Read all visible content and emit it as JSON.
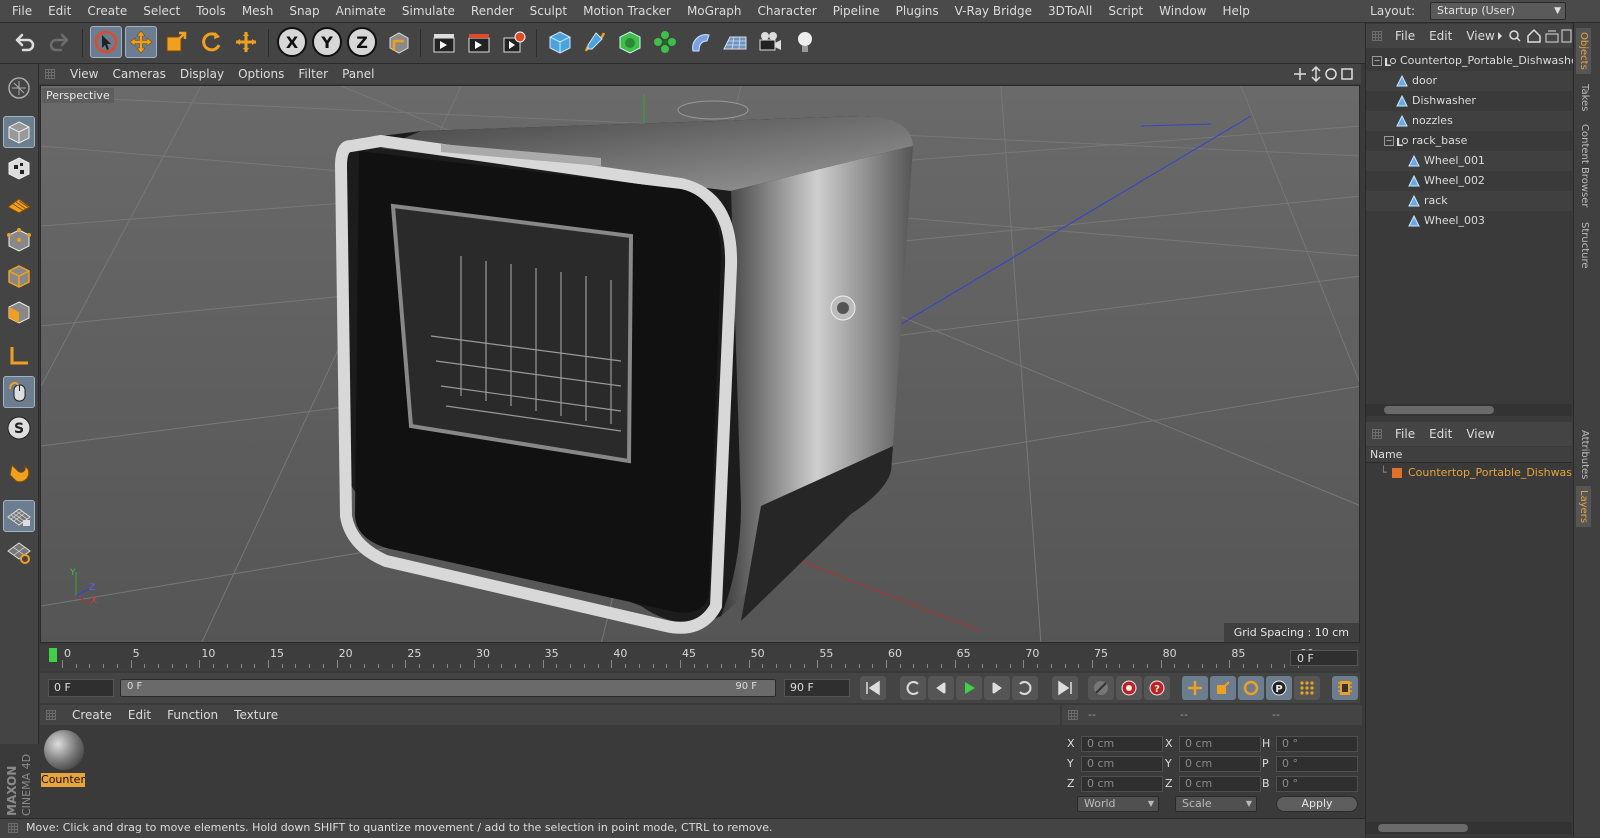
{
  "menubar": {
    "items": [
      "File",
      "Edit",
      "Create",
      "Select",
      "Tools",
      "Mesh",
      "Snap",
      "Animate",
      "Simulate",
      "Render",
      "Sculpt",
      "Motion Tracker",
      "MoGraph",
      "Character",
      "Pipeline",
      "Plugins",
      "V-Ray Bridge",
      "3DToAll",
      "Script",
      "Window",
      "Help"
    ],
    "layout_label": "Layout:",
    "layout_value": "Startup (User)"
  },
  "toolbar": {
    "undo_icon": "undo-icon",
    "axis_x": "X",
    "axis_y": "Y",
    "axis_z": "Z"
  },
  "viewport": {
    "menu": [
      "View",
      "Cameras",
      "Display",
      "Options",
      "Filter",
      "Panel"
    ],
    "camera_label": "Perspective",
    "grid_spacing": "Grid Spacing : 10 cm",
    "axis_x": "X",
    "axis_y": "Y",
    "axis_z": "Z"
  },
  "timeline": {
    "labels": [
      "0",
      "5",
      "10",
      "15",
      "20",
      "25",
      "30",
      "35",
      "40",
      "45",
      "50",
      "55",
      "60",
      "65",
      "70",
      "75",
      "80",
      "85",
      "90"
    ],
    "end_field": "0 F"
  },
  "transport": {
    "current_frame": "0 F",
    "range_start": "0 F",
    "range_end_inner": "90 F",
    "range_end": "90 F"
  },
  "material_manager": {
    "menu": [
      "Create",
      "Edit",
      "Function",
      "Texture"
    ],
    "material_name": "Counter"
  },
  "coordinates": {
    "headers": [
      "--",
      "--",
      "--"
    ],
    "rows": [
      {
        "l1": "X",
        "v1": "0 cm",
        "l2": "X",
        "v2": "0 cm",
        "l3": "H",
        "v3": "0 °"
      },
      {
        "l1": "Y",
        "v1": "0 cm",
        "l2": "Y",
        "v2": "0 cm",
        "l3": "P",
        "v3": "0 °"
      },
      {
        "l1": "Z",
        "v1": "0 cm",
        "l2": "Z",
        "v2": "0 cm",
        "l3": "B",
        "v3": "0 °"
      }
    ],
    "space_select": "World",
    "mode_select": "Scale",
    "apply_label": "Apply"
  },
  "status_text": "Move: Click and drag to move elements. Hold down SHIFT to quantize movement / add to the selection in point mode, CTRL to remove.",
  "brand": {
    "line1": "MAXON",
    "line2": "CINEMA 4D"
  },
  "objects_panel": {
    "menu": [
      "File",
      "Edit",
      "View"
    ],
    "items": [
      {
        "name": "Countertop_Portable_Dishwasher_",
        "depth": 0,
        "kind": "null"
      },
      {
        "name": "door",
        "depth": 1,
        "kind": "poly"
      },
      {
        "name": "Dishwasher",
        "depth": 1,
        "kind": "poly"
      },
      {
        "name": "nozzles",
        "depth": 1,
        "kind": "poly"
      },
      {
        "name": "rack_base",
        "depth": 1,
        "kind": "null"
      },
      {
        "name": "Wheel_001",
        "depth": 2,
        "kind": "poly"
      },
      {
        "name": "Wheel_002",
        "depth": 2,
        "kind": "poly"
      },
      {
        "name": "rack",
        "depth": 2,
        "kind": "poly"
      },
      {
        "name": "Wheel_003",
        "depth": 2,
        "kind": "poly"
      }
    ]
  },
  "layers_panel": {
    "menu": [
      "File",
      "Edit",
      "View"
    ],
    "column_name": "Name",
    "layer_name": "Countertop_Portable_Dishwasher",
    "layer_color": "#e0702a"
  },
  "side_tabs": [
    "Objects",
    "Takes",
    "Content Browser",
    "Structure",
    "Attributes",
    "Layers"
  ],
  "colors": {
    "accent": "#e8a33c",
    "selected_tool": "#6c7d90"
  }
}
